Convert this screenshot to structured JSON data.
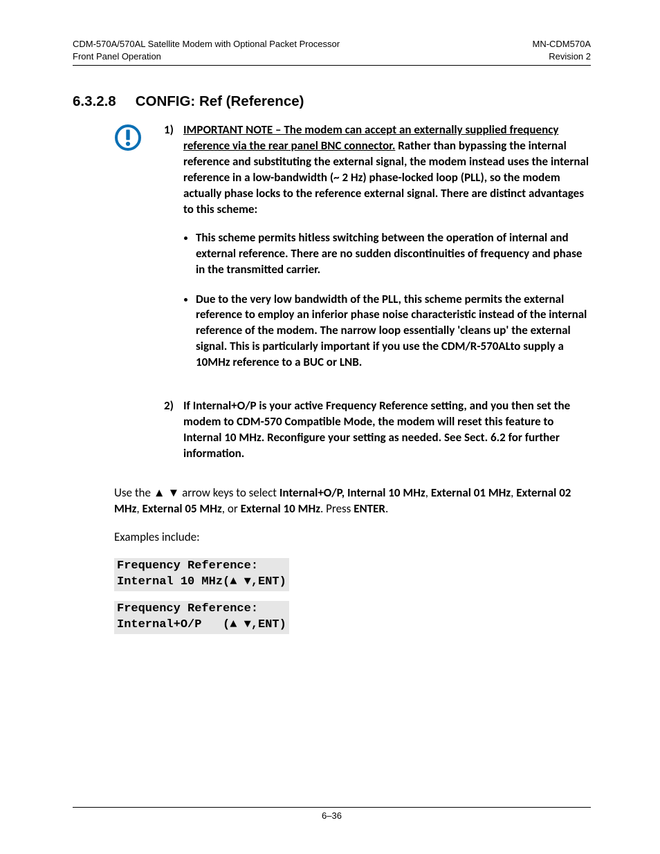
{
  "header": {
    "left1": "CDM-570A/570AL Satellite Modem with Optional Packet Processor",
    "left2": "Front Panel Operation",
    "right1": "MN-CDM570A",
    "right2": "Revision 2"
  },
  "heading": {
    "number": "6.3.2.8",
    "title": "CONFIG: Ref (Reference)"
  },
  "note1": {
    "num": "1)",
    "lead_underlined": "IMPORTANT NOTE – The modem can accept an externally supplied frequency reference via the rear panel BNC connector.",
    "rest": " Rather than bypassing the internal reference and substituting the external signal, the modem instead uses the internal reference in a low-bandwidth (~ 2 Hz) phase-locked loop (PLL), so the modem actually phase locks to the reference external signal. There are distinct advantages to this scheme:"
  },
  "bullets": {
    "b1": "This scheme permits hitless switching between the operation of internal and external reference. There are no sudden discontinuities of frequency and phase in the transmitted carrier.",
    "b2": "Due to the very low bandwidth of the PLL, this scheme permits the external reference to employ an inferior phase noise characteristic instead of the internal reference of the modem. The narrow loop essentially 'cleans up' the external signal. This is particularly important if you use the CDM/R-570ALto supply a 10MHz reference to a BUC or LNB."
  },
  "note2": {
    "num": "2)",
    "text": "If Internal+O/P is your active Frequency Reference setting, and you then set the modem to CDM-570 Compatible Mode, the modem will reset this feature to Internal 10 MHz. Reconfigure your setting as needed. See Sect. 6.2 for further information."
  },
  "para": {
    "p1a": "Use the ▲ ▼ arrow keys to select ",
    "p1b": "Internal+O/P, Internal 10 MHz",
    "p1c": ", ",
    "p1d": "External 01 MHz",
    "p1e": ", ",
    "p1f": "External 02 MHz",
    "p1g": ", ",
    "p1h": "External 05 MHz",
    "p1i": ", or ",
    "p1j": "External 10 MHz",
    "p1k": ". Press ",
    "p1l": "ENTER",
    "p1m": "."
  },
  "examples_label": "Examples include:",
  "code1": "Frequency Reference:\nInternal 10 MHz(▲ ▼,ENT)",
  "code2": "Frequency Reference:\nInternal+O/P   (▲ ▼,ENT)",
  "footer": "6–36"
}
